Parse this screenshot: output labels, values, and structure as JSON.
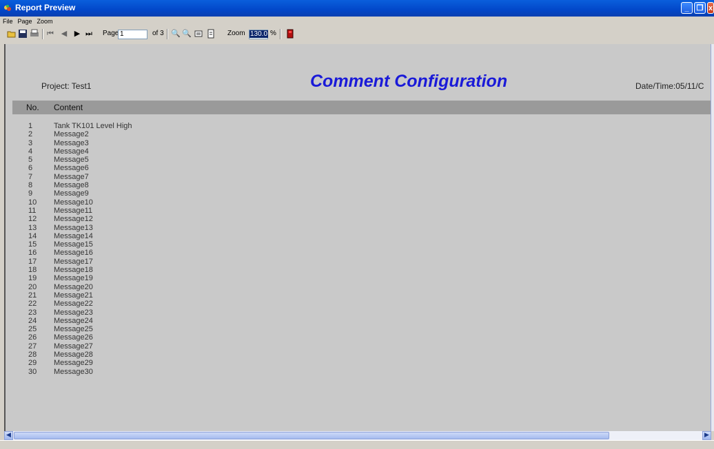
{
  "window": {
    "title": "Report Preview"
  },
  "menu": [
    "File",
    "Page",
    "Zoom"
  ],
  "toolbar": {
    "page_label": "Page",
    "page_value": "1",
    "page_of": "of 3",
    "zoom_label": "Zoom",
    "zoom_value": "130.0",
    "zoom_unit": "%"
  },
  "report": {
    "project": "Project: Test1",
    "title": "Comment Configuration",
    "datetime": "Date/Time:05/11/C",
    "columns": {
      "no": "No.",
      "content": "Content"
    },
    "rows": [
      {
        "no": "1",
        "content": "Tank TK101 Level High"
      },
      {
        "no": "2",
        "content": "Message2"
      },
      {
        "no": "3",
        "content": "Message3"
      },
      {
        "no": "4",
        "content": "Message4"
      },
      {
        "no": "5",
        "content": "Message5"
      },
      {
        "no": "6",
        "content": "Message6"
      },
      {
        "no": "7",
        "content": "Message7"
      },
      {
        "no": "8",
        "content": "Message8"
      },
      {
        "no": "9",
        "content": "Message9"
      },
      {
        "no": "10",
        "content": "Message10"
      },
      {
        "no": "11",
        "content": "Message11"
      },
      {
        "no": "12",
        "content": "Message12"
      },
      {
        "no": "13",
        "content": "Message13"
      },
      {
        "no": "14",
        "content": "Message14"
      },
      {
        "no": "15",
        "content": "Message15"
      },
      {
        "no": "16",
        "content": "Message16"
      },
      {
        "no": "17",
        "content": "Message17"
      },
      {
        "no": "18",
        "content": "Message18"
      },
      {
        "no": "19",
        "content": "Message19"
      },
      {
        "no": "20",
        "content": "Message20"
      },
      {
        "no": "21",
        "content": "Message21"
      },
      {
        "no": "22",
        "content": "Message22"
      },
      {
        "no": "23",
        "content": "Message23"
      },
      {
        "no": "24",
        "content": "Message24"
      },
      {
        "no": "25",
        "content": "Message25"
      },
      {
        "no": "26",
        "content": "Message26"
      },
      {
        "no": "27",
        "content": "Message27"
      },
      {
        "no": "28",
        "content": "Message28"
      },
      {
        "no": "29",
        "content": "Message29"
      },
      {
        "no": "30",
        "content": "Message30"
      }
    ]
  },
  "colors": {
    "title_bar": "#0247c9",
    "report_title": "#1a1ad8",
    "header_row": "#9a9a9a",
    "page_bg": "#c9c9c9"
  }
}
